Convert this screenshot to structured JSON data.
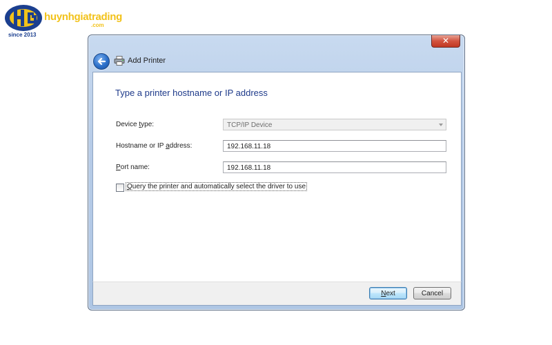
{
  "watermark": {
    "brand": "huynhgiatrading",
    "domain": ".com",
    "since": "since 2013",
    "colors": {
      "brand_text": "#f2c21a",
      "mark_blue": "#1b3f8f"
    }
  },
  "window": {
    "close_symbol": "✕",
    "nav": {
      "back_icon": "back-arrow-icon",
      "printer_icon": "printer-icon",
      "title": "Add Printer"
    },
    "heading": "Type a printer hostname or IP address",
    "form": {
      "device_type": {
        "label_pre": "Device ",
        "label_accel": "t",
        "label_post": "ype:",
        "value": "TCP/IP Device",
        "disabled": true
      },
      "hostname": {
        "label_pre": "Hostname or IP ",
        "label_accel": "a",
        "label_post": "ddress:",
        "value": "192.168.11.18"
      },
      "port_name": {
        "label_pre": "",
        "label_accel": "P",
        "label_post": "ort name:",
        "value": "192.168.11.18"
      },
      "query_checkbox": {
        "label_accel": "Q",
        "label_post": "uery the printer and automatically select the driver to use",
        "checked": false
      }
    },
    "buttons": {
      "next": {
        "accel": "N",
        "rest": "ext"
      },
      "cancel": "Cancel"
    },
    "colors": {
      "heading": "#1e3a8a",
      "frame": "#b6cbe7"
    }
  }
}
